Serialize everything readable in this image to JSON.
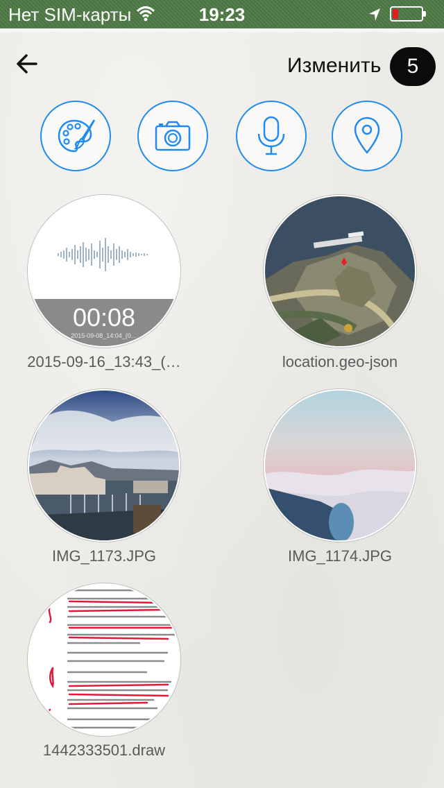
{
  "status_bar": {
    "carrier": "Нет SIM-карты",
    "time": "19:23",
    "wifi_icon": "wifi-icon",
    "location_icon": "location-arrow-icon",
    "battery_icon": "battery-low-icon",
    "battery_level": 0.15
  },
  "header": {
    "back_icon": "back-arrow-icon",
    "edit_label": "Изменить",
    "count": "5"
  },
  "actions": [
    {
      "name": "draw-button",
      "icon": "palette-brush-icon"
    },
    {
      "name": "camera-button",
      "icon": "camera-icon"
    },
    {
      "name": "voice-button",
      "icon": "microphone-icon"
    },
    {
      "name": "location-button",
      "icon": "map-pin-icon"
    }
  ],
  "attachments": [
    {
      "caption": "2015-09-16_13:43_(…",
      "kind": "audio",
      "duration": "00:08",
      "subcaption": "2015-09-08_14:04_(0…"
    },
    {
      "caption": "location.geo-json",
      "kind": "map"
    },
    {
      "caption": "IMG_1173.JPG",
      "kind": "photo"
    },
    {
      "caption": "IMG_1174.JPG",
      "kind": "photo"
    },
    {
      "caption": "1442333501.draw",
      "kind": "drawing"
    }
  ],
  "colors": {
    "accent": "#1f8bf0",
    "status_bar": "#4d7a45",
    "background": "#ecebe6",
    "badge": "#0b0b0b"
  }
}
